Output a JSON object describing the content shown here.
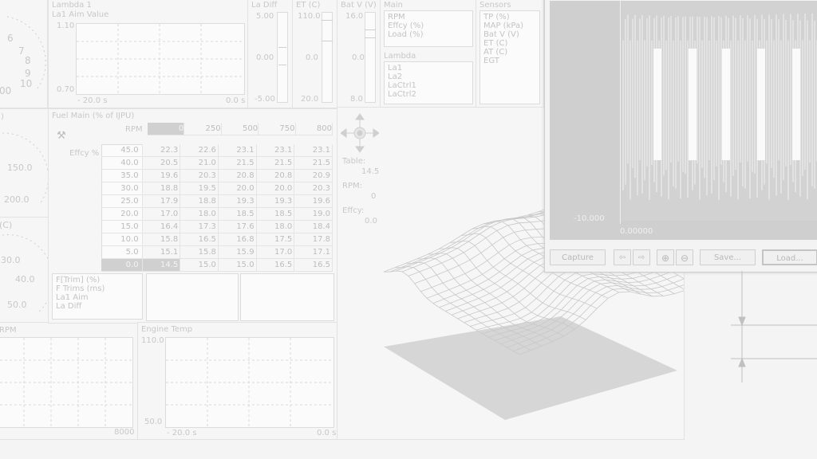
{
  "top": {
    "lambda_title": "Lambda 1",
    "lambda_series": "La1 Aim Value",
    "lambda_ymax": "1.10",
    "lambda_ymin": "0.70",
    "lambda_xmin": "- 20.0 s",
    "lambda_xmax": "0.0 s",
    "tacho_labels": [
      "6",
      "7",
      "8",
      "9",
      "10",
      "00"
    ],
    "la_diff": {
      "title": "La Diff",
      "top": "5.00",
      "mid": "0.00",
      "bot": "-5.00"
    },
    "et": {
      "title": "ET (C)",
      "top": "110.0",
      "mid": "0.0",
      "bot": "20.0"
    },
    "bat": {
      "title": "Bat V (V)",
      "top": "16.0",
      "mid": "0.0",
      "bot": "8.0"
    },
    "main": {
      "title": "Main",
      "items": [
        "RPM",
        "Effcy (%)",
        "Load (%)"
      ]
    },
    "lambda_list": {
      "title": "Lambda",
      "items": [
        "La1",
        "La2",
        "LaCtrl1",
        "LaCtrl2"
      ]
    },
    "sensors": {
      "title": "Sensors",
      "items": [
        "TP (%)",
        "MAP (kPa)",
        "Bat V (V)",
        "ET (C)",
        "AT (C)",
        "EGT"
      ]
    }
  },
  "left_gauges": {
    "g1_labels": [
      "150.0",
      "200.0"
    ],
    "g1_title": ")",
    "g2_title": "(C)",
    "g2_labels": [
      "30.0",
      "40.0",
      "50.0"
    ],
    "rpm_title": "RPM",
    "rpm_max": "8000"
  },
  "fuel": {
    "title": "Fuel Main (% of IJPU)",
    "rpm_label": "RPM",
    "effcy_label": "Effcy %",
    "rpm_values": [
      "0",
      "250",
      "500",
      "750",
      "800"
    ],
    "rows": [
      {
        "load": "45.0",
        "cells": [
          "22.3",
          "22.6",
          "23.1",
          "23.1",
          "23.1"
        ]
      },
      {
        "load": "40.0",
        "cells": [
          "20.5",
          "21.0",
          "21.5",
          "21.5",
          "21.5"
        ]
      },
      {
        "load": "35.0",
        "cells": [
          "19.6",
          "20.3",
          "20.8",
          "20.8",
          "20.9"
        ]
      },
      {
        "load": "30.0",
        "cells": [
          "18.8",
          "19.5",
          "20.0",
          "20.0",
          "20.3"
        ]
      },
      {
        "load": "25.0",
        "cells": [
          "17.9",
          "18.8",
          "19.3",
          "19.3",
          "19.6"
        ]
      },
      {
        "load": "20.0",
        "cells": [
          "17.0",
          "18.0",
          "18.5",
          "18.5",
          "19.0"
        ]
      },
      {
        "load": "15.0",
        "cells": [
          "16.4",
          "17.3",
          "17.6",
          "18.0",
          "18.4"
        ]
      },
      {
        "load": "10.0",
        "cells": [
          "15.8",
          "16.5",
          "16.8",
          "17.5",
          "17.8"
        ]
      },
      {
        "load": "5.0",
        "cells": [
          "15.1",
          "15.8",
          "15.9",
          "17.0",
          "17.1"
        ]
      },
      {
        "load": "0.0",
        "cells": [
          "14.5",
          "15.0",
          "15.0",
          "16.5",
          "16.5"
        ]
      }
    ],
    "trim_list": [
      "F[Trim] (%)",
      "F Trims (ms)",
      "La1 Aim",
      "La Diff"
    ]
  },
  "info": {
    "table_label": "Table:",
    "table_value": "14.5",
    "rpm_label": "RPM:",
    "rpm_value": "0",
    "effcy_label": "Effcy:",
    "effcy_value": "0.0"
  },
  "engine_temp": {
    "title": "Engine Temp",
    "ymax": "110.0",
    "ymin": "50.0",
    "xmin": "- 20.0 s",
    "xmax": "0.0 s"
  },
  "scope": {
    "y_label": "-10.000",
    "x_label": "0.00000",
    "buttons": {
      "capture": "Capture",
      "save": "Save...",
      "load": "Load..."
    }
  }
}
